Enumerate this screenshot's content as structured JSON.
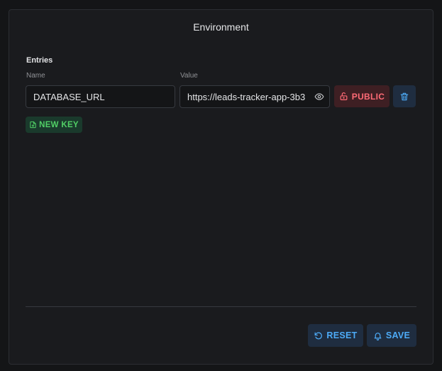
{
  "dialog": {
    "title": "Environment",
    "section_label": "Entries",
    "columns": {
      "name": "Name",
      "value": "Value"
    },
    "entries": [
      {
        "name": "DATABASE_URL",
        "value": "https://leads-tracker-app-3b3"
      }
    ],
    "visibility_label": "PUBLIC",
    "new_key_label": "NEW KEY",
    "reset_label": "RESET",
    "save_label": "SAVE"
  },
  "icons": {
    "visibility": "eye-icon",
    "public": "unlock-icon",
    "delete": "trash-icon",
    "new_key": "file-plus-icon",
    "reset": "reset-icon",
    "save": "bell-icon"
  },
  "colors": {
    "background": "#1a1b1e",
    "danger": "#ff6b76",
    "accent": "#4dabf7",
    "success": "#51cf66"
  }
}
